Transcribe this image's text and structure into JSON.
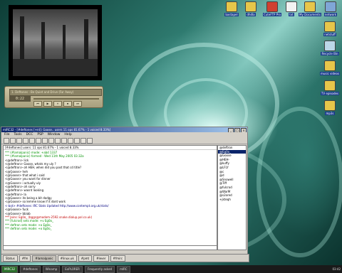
{
  "desktop_icons_top": [
    {
      "label": "bastapel",
      "icon": "folder-icon"
    },
    {
      "label": "dhdla",
      "icon": "folder-icon"
    },
    {
      "label": "CuteFTP Pro",
      "icon": "ftp-icon"
    },
    {
      "label": "txt",
      "icon": "text-file-icon"
    },
    {
      "label": "My Documents",
      "icon": "documents-icon"
    },
    {
      "label": "network",
      "icon": "network-icon"
    }
  ],
  "desktop_icons_right": [
    {
      "label": "netstuff",
      "icon": "folder-icon"
    },
    {
      "label": "Recycle Bin",
      "icon": "recycle-bin-icon"
    },
    {
      "label": "music videos",
      "icon": "folder-icon"
    },
    {
      "label": "TV episodes",
      "icon": "folder-icon"
    },
    {
      "label": "mp3s",
      "icon": "folder-icon"
    }
  ],
  "player": {
    "display": "1. Deftones - Be Quiet and Drive (Far Away)",
    "time": "0:22",
    "buttons": [
      "⏮",
      "▶",
      "⏸",
      "⏹",
      "⏭"
    ]
  },
  "mirc": {
    "title": "mIRC32 - [#deftones [+nt]: Goose.. users 11 ops 81.67% - 1 voiced 8.33%]",
    "menu": [
      "File",
      "Tools",
      "DCC",
      "PSP",
      "Window",
      "Help"
    ],
    "topic": "[#deftones] users: 11 ops 81.67% - 1 voiced 8.33%",
    "lines": [
      {
        "text": "*** (#lamalpanic) mode: +abd 1337",
        "color": "green"
      },
      {
        "text": "*** (#lamalpanic) formed - Wed 11th May 2005 03:32a",
        "color": "green"
      },
      {
        "text": "<@deftron> lick",
        "color": "black"
      },
      {
        "text": "<@deftron> Goose, whats my uly ?",
        "color": "black"
      },
      {
        "text": "<@deftron> oh HEH, when did you post that cd title?",
        "color": "black"
      },
      {
        "text": "<@Goose> heh",
        "color": "black"
      },
      {
        "text": "<@Goose> that what i said",
        "color": "black"
      },
      {
        "text": "<@Goose> you want for dinner",
        "color": "black"
      },
      {
        "text": "<@Goose> i actually uly",
        "color": "black"
      },
      {
        "text": "<@deftron> oh sorry",
        "color": "black"
      },
      {
        "text": "<@deftron> wasnt looking",
        "color": "black"
      },
      {
        "text": "<@deftron> la",
        "color": "black"
      },
      {
        "text": "<@Goose> its being a bit dodgy",
        "color": "black"
      },
      {
        "text": "<@Goose> so lemme know if it dont work",
        "color": "black"
      },
      {
        "text": "<-bot> #deftones: IRC Stats Updated http://www.contempt.org.uk/stats/",
        "color": "blue"
      },
      {
        "text": "<@Goose> fuck",
        "color": "black"
      },
      {
        "text": "<@Goose> bbiab",
        "color": "black"
      },
      {
        "text": "*** Joins: Eg0o_ (bggs@modem-2592.snake.dialup.pol.co.uk)",
        "color": "red"
      },
      {
        "text": "*** [fulcrod] sets mode: +v Eg0o_",
        "color": "green"
      },
      {
        "text": "*** deftron sets mode: +o Eg0o_",
        "color": "green"
      },
      {
        "text": "*** deftron sets mode: +o Eg0o_",
        "color": "green"
      }
    ],
    "nicks": [
      "@deftron",
      "@Eg0o_",
      "@Goose",
      "@HEH-",
      "@kuffy",
      "@LFLY",
      "@c",
      "@d",
      "@Snowell",
      "@Tiff",
      "@fulcrod",
      "@WarM",
      "@s2ored",
      "+jkteqh"
    ]
  },
  "switchbar": [
    "Status",
    "#fm",
    "#lamalpanic",
    "#linux.uk",
    "#pmt",
    "#lever",
    "#fmirc"
  ],
  "taskbar": {
    "items": [
      "MIRC32",
      "#deftones",
      "Winamp",
      "ExPLORER",
      "Frequently asked",
      "mIRC"
    ],
    "clock": "03:42"
  }
}
